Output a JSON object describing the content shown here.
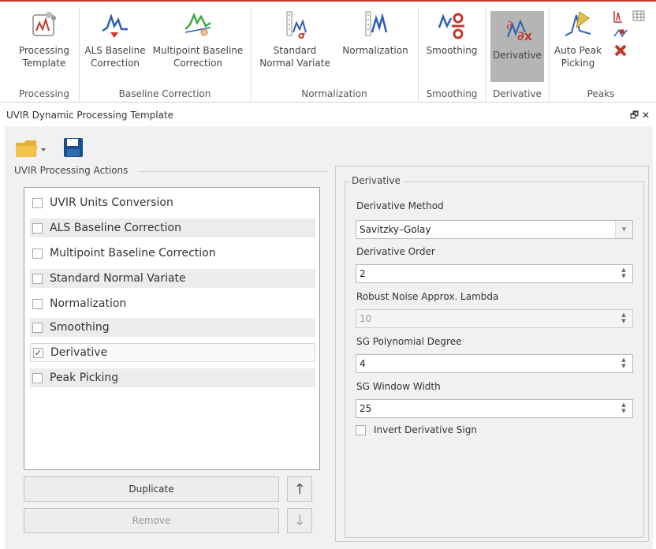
{
  "ribbon": {
    "buttons": [
      {
        "label": "Processing\nTemplate",
        "icon": "processing-template-icon"
      },
      {
        "label": "ALS Baseline\nCorrection",
        "icon": "als-baseline-icon"
      },
      {
        "label": "Multipoint Baseline\nCorrection",
        "icon": "multipoint-baseline-icon"
      },
      {
        "label": "Standard\nNormal Variate",
        "icon": "snv-icon"
      },
      {
        "label": "Normalization",
        "icon": "normalization-icon"
      },
      {
        "label": "Smoothing",
        "icon": "smoothing-icon"
      },
      {
        "label": "Derivative",
        "icon": "derivative-icon"
      },
      {
        "label": "Auto Peak\nPicking",
        "icon": "auto-peak-picking-icon"
      }
    ],
    "groups": [
      "Processing",
      "Baseline Correction",
      "Normalization",
      "Smoothing",
      "Derivative",
      "Peaks"
    ],
    "colors": {
      "accent": "#c0392b",
      "active": "#b5b5b5"
    }
  },
  "panel": {
    "title": "UVIR Dynamic Processing Template",
    "controls": "🗗 ✕"
  },
  "actions": {
    "group_label": "UVIR Processing Actions",
    "items": [
      {
        "label": "UVIR Units Conversion",
        "checked": false
      },
      {
        "label": "ALS Baseline Correction",
        "checked": false
      },
      {
        "label": "Multipoint Baseline Correction",
        "checked": false
      },
      {
        "label": "Standard Normal Variate",
        "checked": false
      },
      {
        "label": "Normalization",
        "checked": false
      },
      {
        "label": "Smoothing",
        "checked": false
      },
      {
        "label": "Derivative",
        "checked": true
      },
      {
        "label": "Peak Picking",
        "checked": false
      }
    ],
    "duplicate_label": "Duplicate",
    "remove_label": "Remove",
    "up_arrow": "↑",
    "down_arrow": "↓"
  },
  "derivative": {
    "group_label": "Derivative",
    "method_label": "Derivative Method",
    "method_value": "Savitzky–Golay",
    "order_label": "Derivative Order",
    "order_value": "2",
    "lambda_label": "Robust Noise Approx. Lambda",
    "lambda_value": "10",
    "poly_label": "SG Polynomial Degree",
    "poly_value": "4",
    "window_label": "SG Window Width",
    "window_value": "25",
    "invert_label": "Invert Derivative Sign",
    "invert_checked": false
  }
}
